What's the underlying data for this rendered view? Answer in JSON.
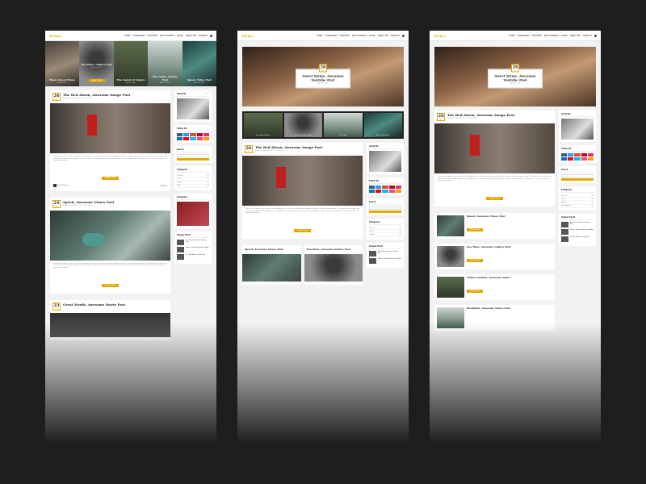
{
  "brand": {
    "logo": "Wuloo",
    "accent": "#e0a800"
  },
  "nav": [
    "HOME",
    "CATEGORIES",
    "FEATURES",
    "POST FORMATS",
    "PAGES",
    "ABOUT ME",
    "CONTACT"
  ],
  "slider": [
    {
      "title": "Home Sweet Home",
      "date": "April 26, 2017"
    },
    {
      "title": "Sea Tales, Gallery Post",
      "date": "April 26, 2017"
    },
    {
      "title": "The Sound of Nature",
      "date": "April 26, 2017"
    },
    {
      "title": "The Cabin, Gallery Post",
      "date": "April 26, 2017"
    },
    {
      "title": "Speed, Video Post",
      "date": "April 26, 2017"
    }
  ],
  "button_read": "READ MORE",
  "posts": [
    {
      "day": "26",
      "month": "APR",
      "title": "The Red Alarm, Awesome Image Post",
      "meta": "by Admin · April 26, 2017 · 3 Comments",
      "author": "Naomi Graham"
    },
    {
      "day": "24",
      "month": "APR",
      "title": "Speed, Awesome Vimeo Post",
      "meta": "by Admin · April 24, 2017 · 2 Comments",
      "author": "Naomi Graham"
    },
    {
      "day": "23",
      "month": "APR",
      "title": "Great Words, Awesome Quote Post",
      "meta": "by Admin · April 23, 2017",
      "author": "Naomi Graham"
    }
  ],
  "excerpt": "Lorem ipsum dolor sit amet, consectetur adipiscing elit, sed do eiusmod tempor incididunt ut labore et dolore magna aliqua. Ut enim ad minim veniam, quis nostrud exercitation ullamco laboris nisi ut aliquip ex ea commodo consequat. Duis aute irure dolor in reprehenderit in voluptate velit esse cillum dolore eu fugiat nulla pariatur.",
  "sidebar": {
    "about": "About Me",
    "follow": "Follow Me",
    "search": "Search",
    "categories": "Categories",
    "popular": "Popular Posts",
    "instagram": "Instagram",
    "more": "view all",
    "cats": [
      {
        "name": "Lifestyle",
        "count": "(5)"
      },
      {
        "name": "Travel",
        "count": "(8)"
      },
      {
        "name": "Fashion",
        "count": "(4)"
      },
      {
        "name": "Music",
        "count": "(3)"
      },
      {
        "name": "Photography",
        "count": "(6)"
      }
    ],
    "pop": [
      {
        "title": "Sea Tales, Awesome Gallery Post"
      },
      {
        "title": "Nature Sounds, Awesome Audio"
      },
      {
        "title": "The Red Alarm, Image Post"
      }
    ]
  },
  "hero": {
    "day": "26",
    "month": "APR",
    "title": "Sweet Home, Awesome Youtube Post",
    "meta": "April 26, 2017"
  },
  "thumbs": [
    "The Sound of Nature",
    "Sea Tales, Gallery Post",
    "The Cabin",
    "Speed, Video Post"
  ],
  "grid_posts": [
    {
      "title": "Speed, Awesome Vimeo Post"
    },
    {
      "title": "Sea Tales, Awesome Gallery Post"
    }
  ],
  "list_posts": [
    {
      "title": "Speed, Awesome Vimeo Post"
    },
    {
      "title": "Sea Tales, Awesome Gallery Post"
    },
    {
      "title": "Nature Sounds, Awesome Audio"
    },
    {
      "title": "Breakfast, Awesome Vimeo Post"
    }
  ]
}
